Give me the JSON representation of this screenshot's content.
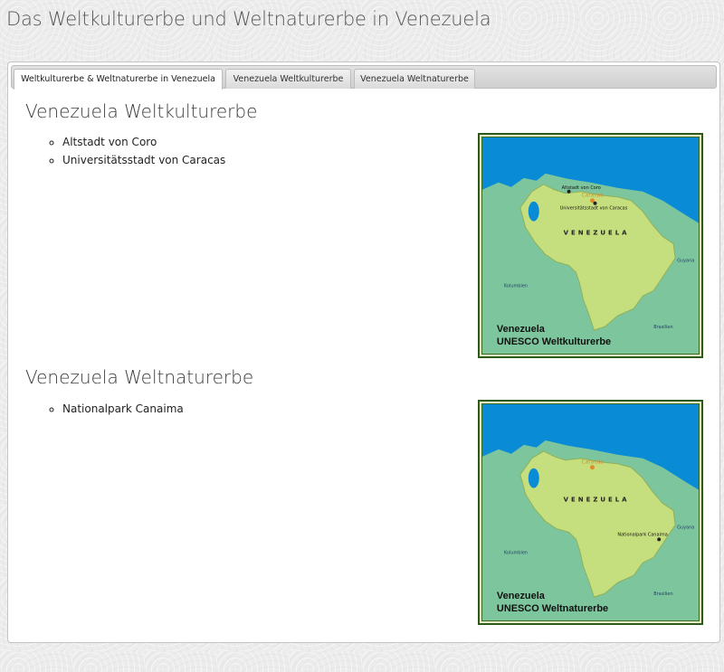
{
  "page": {
    "title": "Das Weltkulturerbe und Weltnaturerbe in Venezuela"
  },
  "tabs": [
    {
      "label": "Weltkulturerbe & Weltnaturerbe in Venezuela",
      "active": true
    },
    {
      "label": "Venezuela Weltkulturerbe",
      "active": false
    },
    {
      "label": "Venezuela Weltnaturerbe",
      "active": false
    }
  ],
  "culture": {
    "heading": "Venezuela Weltkulturerbe",
    "sites": [
      "Altstadt von Coro",
      "Universitätsstadt von Caracas"
    ],
    "map": {
      "caption_line1": "Venezuela",
      "caption_line2": "UNESCO  Weltkulturerbe",
      "country": "VENEZUELA",
      "capital": "Caracas",
      "marker1": "Altstadt von Coro",
      "marker2": "Universitätsstadt von Caracas",
      "neighbor_west": "Kolumbien",
      "neighbor_east": "Guyana",
      "neighbor_south": "Brasilien"
    }
  },
  "nature": {
    "heading": "Venezuela Weltnaturerbe",
    "sites": [
      "Nationalpark Canaima"
    ],
    "map": {
      "caption_line1": "Venezuela",
      "caption_line2": "UNESCO  Weltnaturerbe",
      "country": "VENEZUELA",
      "capital": "Caracas",
      "marker1": "Nationalpark Canaima",
      "neighbor_west": "Kolumbien",
      "neighbor_east": "Guyana",
      "neighbor_south": "Brasilien"
    }
  },
  "colors": {
    "sea": "#0a8bd6",
    "land_neighbors": "#7dc59c",
    "venezuela": "#c6df7e",
    "frame": "#2d5a1a",
    "capital_dot": "#e08a2a"
  }
}
